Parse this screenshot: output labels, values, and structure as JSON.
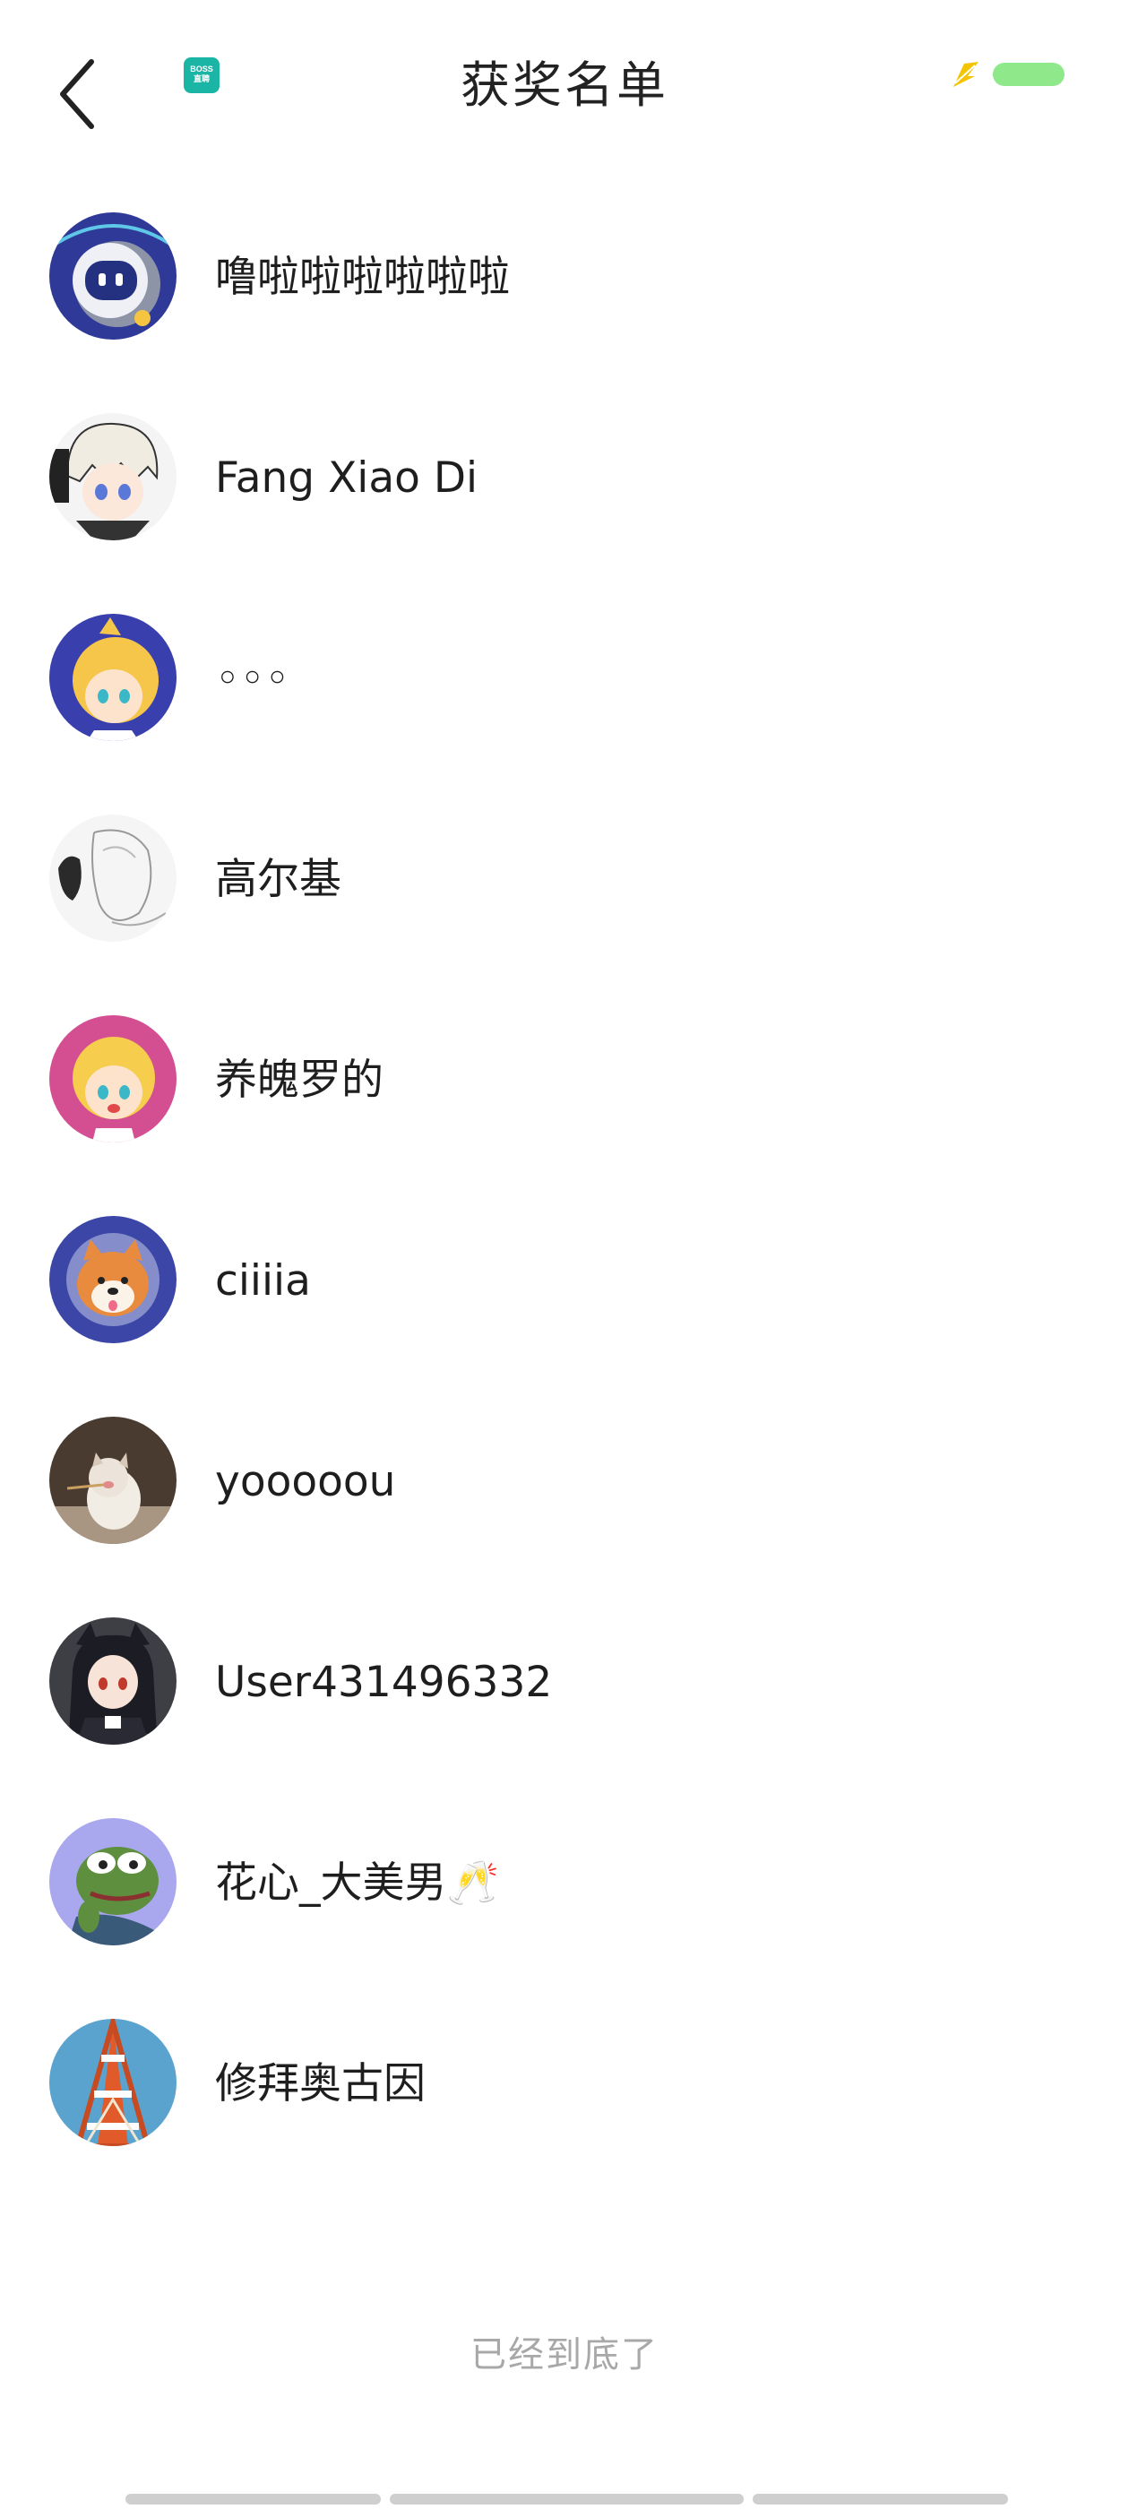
{
  "header": {
    "title": "获奖名单",
    "back_icon": "chevron-left-icon",
    "app_badge_text": "BOSS直聘",
    "app_badge_color": "#1bb5a6",
    "status_bolt_color": "#f5c400",
    "battery_color": "#8fe98a"
  },
  "winners": [
    {
      "name": "噜啦啦啦啦啦啦",
      "avatar": "robot-avatar",
      "avatar_bg": "#3a45a8"
    },
    {
      "name": "Fang Xiao Di",
      "avatar": "anime-boy-avatar",
      "avatar_bg": "#f2f2f2"
    },
    {
      "name": "◦◦◦",
      "avatar": "blonde-girl-avatar",
      "avatar_bg": "#3a3fae"
    },
    {
      "name": "高尔基",
      "avatar": "sketch-avatar",
      "avatar_bg": "#f3f3f3"
    },
    {
      "name": "养魄罗的",
      "avatar": "blonde-girl-pink-avatar",
      "avatar_bg": "#d44f91"
    },
    {
      "name": "ciiiia",
      "avatar": "shiba-dog-avatar",
      "avatar_bg": "#3b46a6"
    },
    {
      "name": "yooooou",
      "avatar": "cat-photo-avatar",
      "avatar_bg": "#4a3b30"
    },
    {
      "name": "User431496332",
      "avatar": "anime-girl-avatar",
      "avatar_bg": "#3e3e45"
    },
    {
      "name": "花心_大美男🥂",
      "avatar": "pepe-frog-avatar",
      "avatar_bg": "#a9a7ee"
    },
    {
      "name": "修拜奥古因",
      "avatar": "tokyo-tower-avatar",
      "avatar_bg": "#5aa3cf"
    }
  ],
  "footer": {
    "end_text": "已经到底了"
  }
}
